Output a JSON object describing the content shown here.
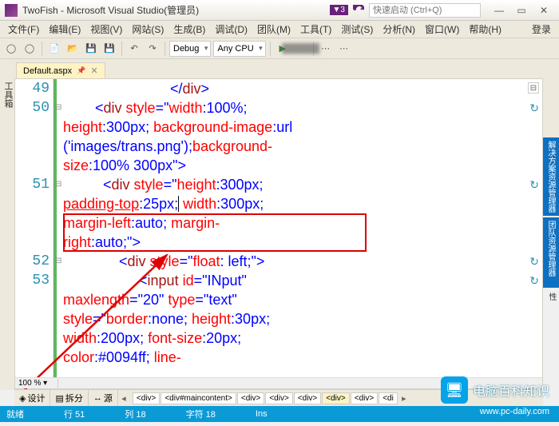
{
  "titlebar": {
    "title": "TwoFish - Microsoft Visual Studio(管理员)",
    "badge": "▼3",
    "quick_placeholder": "快速启动 (Ctrl+Q)"
  },
  "menu": {
    "items": [
      "文件(F)",
      "编辑(E)",
      "视图(V)",
      "网站(S)",
      "生成(B)",
      "调试(D)",
      "团队(M)",
      "工具(T)",
      "测试(S)",
      "分析(N)",
      "窗口(W)",
      "帮助(H)"
    ],
    "login": "登录"
  },
  "toolbar": {
    "config": "Debug",
    "platform": "Any CPU"
  },
  "tab": {
    "label": "Default.aspx"
  },
  "left_panel": "工具箱",
  "right_panels": [
    "解决方案资源管理器",
    "团队资源管理器",
    "属性"
  ],
  "lines": {
    "l49": "49",
    "l50": "50",
    "l51": "51",
    "l52": "52",
    "l53": "53"
  },
  "code": {
    "l49": "</div>",
    "l50_a": "<div ",
    "l50_b": "style",
    "l50_c": "=\"width",
    "l50_d": ":100%; ",
    "l50_e": "height",
    "l50_f": ":300px; ",
    "l50_g": "background-image",
    "l50_h": ":url",
    "l50_i": "('images/trans.png')",
    "l50_j": ";",
    "l50_k": "background-",
    "l50_l": "size",
    "l50_m": ":100% 300px\"",
    "l50_n": ">",
    "l51_a": "<div ",
    "l51_b": "style",
    "l51_c": "=\"height",
    "l51_d": ":300px; ",
    "l51_e": "padding-top",
    "l51_f": ":25px;",
    "l51_g": " width",
    "l51_h": ":300px; ",
    "l51_i": "margin-left",
    "l51_j": ":auto; ",
    "l51_k": "margin-",
    "l51_l": "right",
    "l51_m": ":auto;\"",
    "l51_n": ">",
    "l52_a": "<div ",
    "l52_b": "style",
    "l52_c": "=\"float",
    "l52_d": ": left;\"",
    "l52_e": ">",
    "l53_a": "<input ",
    "l53_b": "id",
    "l53_c": "=\"INput\"",
    "l53_d": "maxlength",
    "l53_e": "=\"20\" ",
    "l53_f": "type",
    "l53_g": "=\"text\"",
    "l53_h": "style",
    "l53_i": "=\"border",
    "l53_j": ":none; ",
    "l53_k": "height",
    "l53_l": ":30px; ",
    "l53_m": "width",
    "l53_n": ":200px; ",
    "l53_o": "font-size",
    "l53_p": ":20px; ",
    "l53_q": "color",
    "l53_r": ":#0094ff; ",
    "l53_s": "line-"
  },
  "zoom": "100 %",
  "design": {
    "design": "设计",
    "split": "拆分",
    "source": "源",
    "crumbs": [
      "<div>",
      "<div#maincontent>",
      "<div>",
      "<div>",
      "<div>",
      "<div>",
      "<div>",
      "<di"
    ]
  },
  "status": {
    "ready": "就绪",
    "line": "行 51",
    "col": "列 18",
    "char": "字符 18",
    "ins": "Ins"
  },
  "watermark": {
    "text": "电脑百科知识",
    "url": "www.pc-daily.com"
  }
}
